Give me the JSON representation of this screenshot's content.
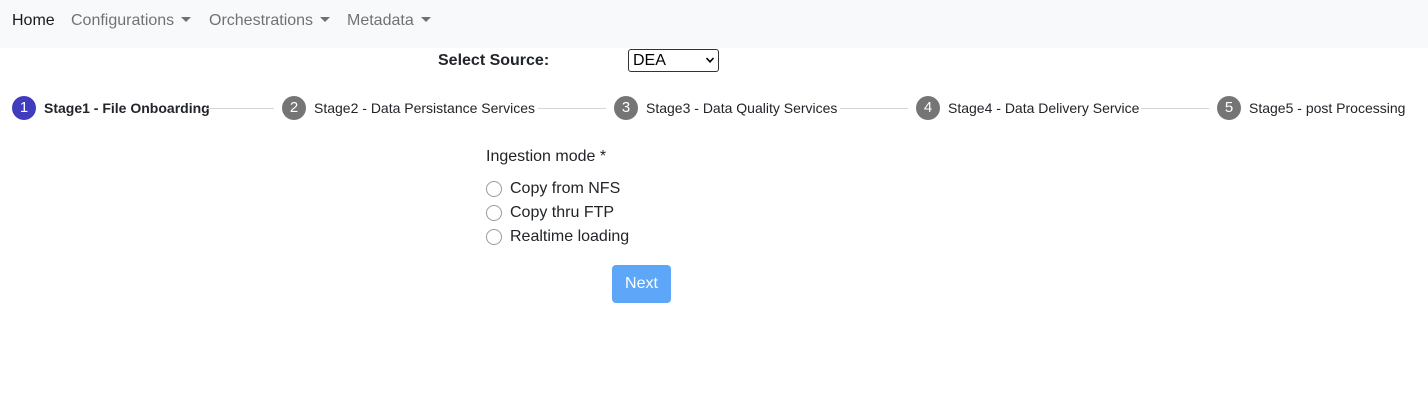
{
  "navbar": {
    "home_label": "Home",
    "items": [
      {
        "label": "Configurations"
      },
      {
        "label": "Orchestrations"
      },
      {
        "label": "Metadata"
      }
    ]
  },
  "source": {
    "label": "Select Source:",
    "selected": "DEA"
  },
  "stepper": {
    "active_index": 0,
    "steps": [
      {
        "number": "1",
        "label": "Stage1 - File Onboarding"
      },
      {
        "number": "2",
        "label": "Stage2 - Data Persistance Services"
      },
      {
        "number": "3",
        "label": "Stage3 - Data Quality Services"
      },
      {
        "number": "4",
        "label": "Stage4 - Data Delivery Service"
      },
      {
        "number": "5",
        "label": "Stage5 - post Processing"
      }
    ]
  },
  "form": {
    "ingestion_label": "Ingestion mode *",
    "options": [
      {
        "label": "Copy from NFS",
        "checked": false
      },
      {
        "label": "Copy thru FTP",
        "checked": false
      },
      {
        "label": "Realtime loading",
        "checked": false
      }
    ],
    "next_label": "Next"
  },
  "colors": {
    "navbar_bg": "#f8f9fa",
    "active_step": "#3f3dbd",
    "inactive_step": "#757575",
    "next_button": "#5ea6f8"
  }
}
